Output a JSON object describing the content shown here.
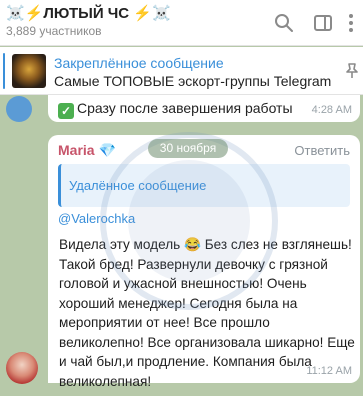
{
  "header": {
    "title": "☠️⚡ЛЮТЫЙ ЧС ⚡☠️",
    "subtitle": "3,889 участников",
    "icons": [
      "search-icon",
      "sidebar-toggle-icon",
      "more-icon"
    ]
  },
  "pinned": {
    "title": "Закреплённое сообщение",
    "text": "Самые ТОПОВЫЕ эскорт-группы Telegram",
    "icon": "pin-icon"
  },
  "top_message": {
    "text": "Сразу после завершения работы",
    "time": "4:28 AM"
  },
  "date_divider": "30 ноября",
  "message": {
    "sender": "Maria",
    "reply_label": "Ответить",
    "quote": "Удалённое сообщение",
    "mention": "@Valerochka",
    "text": "Видела эту модель 😂 Без слез не взглянешь! Такой бред! Развернули девочку с грязной головой и ужасной внешностью! Очень хороший менеджер! Сегодня была на мероприятии от нее! Все прошло великолепно! Все организовала шикарно! Еще и чай был,и продление. Компания была великолепная!",
    "time": "11:12 AM"
  },
  "colors": {
    "accent": "#3a8fd9",
    "sender": "#c7546a",
    "chat_background": "#b7c9a9"
  }
}
